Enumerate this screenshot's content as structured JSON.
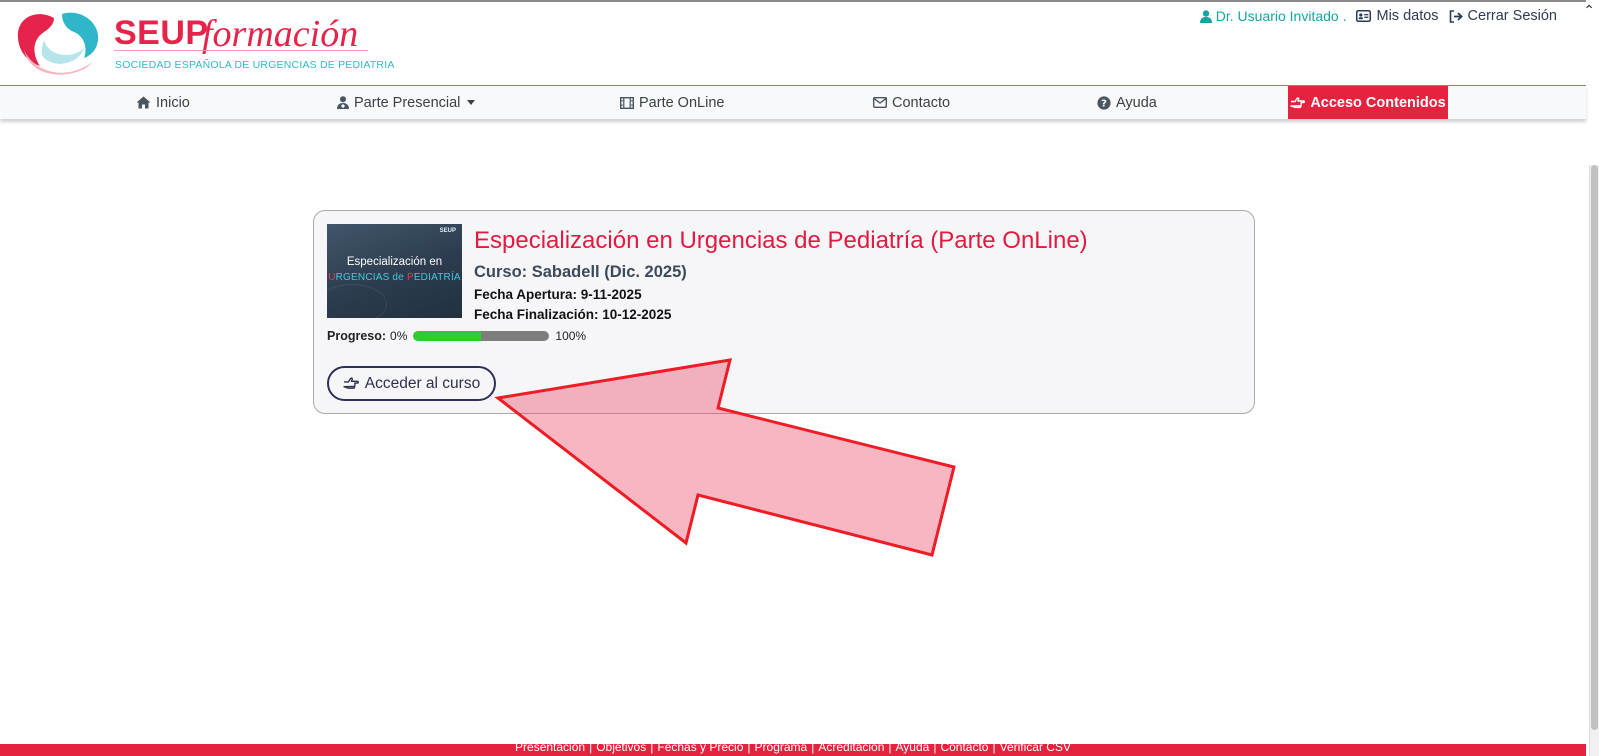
{
  "header": {
    "brand_main": "SEUP",
    "brand_script": "formación",
    "brand_subtitle": "SOCIEDAD ESPAÑOLA DE URGENCIAS DE PEDIATRIA",
    "user_name": "Dr. Usuario Invitado .",
    "my_data_label": "Mis datos",
    "logout_label": "Cerrar Sesión"
  },
  "nav": {
    "items": [
      {
        "label": "Inicio",
        "icon": "home-icon"
      },
      {
        "label": "Parte Presencial",
        "icon": "user-md-icon"
      },
      {
        "label": "Parte OnLine",
        "icon": "film-icon"
      },
      {
        "label": "Contacto",
        "icon": "envelope-icon"
      },
      {
        "label": "Ayuda",
        "icon": "question-circle-icon"
      }
    ],
    "cta_label": "Acceso Contenidos",
    "cta_icon": "hand-point-right-icon",
    "cta_color": "#e6233f"
  },
  "course": {
    "thumb_line1": "Especialización en",
    "thumb_line2_prefix": "U",
    "thumb_line2_mid": "RGENCIAS de ",
    "thumb_line2_r": "P",
    "thumb_line2_end": "EDIATRÍA",
    "thumb_badge": "SEUP",
    "title": "Especialización en Urgencias de Pediatría (Parte OnLine)",
    "subtitle": "Curso: Sabadell (Dic. 2025)",
    "open_date": "Fecha Apertura: 9-11-2025",
    "end_date": "Fecha Finalización: 10-12-2025",
    "progress_label": "Progreso:",
    "progress_min": "0%",
    "progress_max": "100%",
    "progress_value": 0.5,
    "access_button_label": "Acceder al curso",
    "title_color": "#e21a3f"
  },
  "footer": {
    "links": [
      "Presentación",
      "Objetivos",
      "Fechas y Precio",
      "Programa",
      "Acreditación",
      "Ayuda",
      "Contacto",
      "Verificar CSV"
    ],
    "color": "#e6233f"
  }
}
